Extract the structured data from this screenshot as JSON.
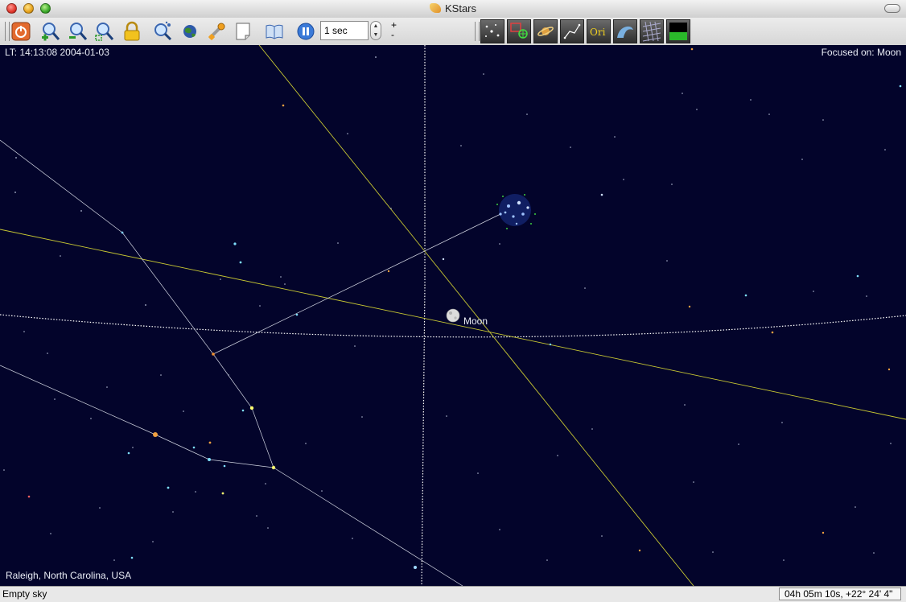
{
  "window": {
    "title": "KStars"
  },
  "toolbar": {
    "time_step": "1 sec",
    "plus": "+",
    "minus": "-",
    "left_tools": [
      {
        "name": "power-icon"
      },
      {
        "name": "zoom-in-icon"
      },
      {
        "name": "zoom-out-icon"
      },
      {
        "name": "zoom-default-icon"
      },
      {
        "name": "lock-icon"
      },
      {
        "name": "find-object-icon"
      },
      {
        "name": "earth-icon"
      },
      {
        "name": "wrench-icon"
      },
      {
        "name": "note-icon"
      },
      {
        "name": "book-icon"
      },
      {
        "name": "pause-icon"
      }
    ],
    "right_tools": [
      {
        "name": "toggle-stars-icon"
      },
      {
        "name": "toggle-deep-sky-icon"
      },
      {
        "name": "toggle-planets-icon"
      },
      {
        "name": "toggle-constellation-lines-icon"
      },
      {
        "name": "toggle-constellation-names-icon",
        "label": "Ori"
      },
      {
        "name": "toggle-milky-way-icon"
      },
      {
        "name": "toggle-coordinate-grid-icon"
      },
      {
        "name": "toggle-ground-icon"
      }
    ]
  },
  "sky": {
    "local_time": "LT: 14:13:08   2004-01-03",
    "focused": "Focused on: Moon",
    "location": "Raleigh, North Carolina,  USA",
    "moon_label": "Moon"
  },
  "status": {
    "object": "Empty sky",
    "coords": "04h 05m 10s,  +22° 24' 4\""
  },
  "colors": {
    "sky_bg": "#03042b",
    "ecliptic": "#c8c832",
    "equator": "#ffffff"
  }
}
